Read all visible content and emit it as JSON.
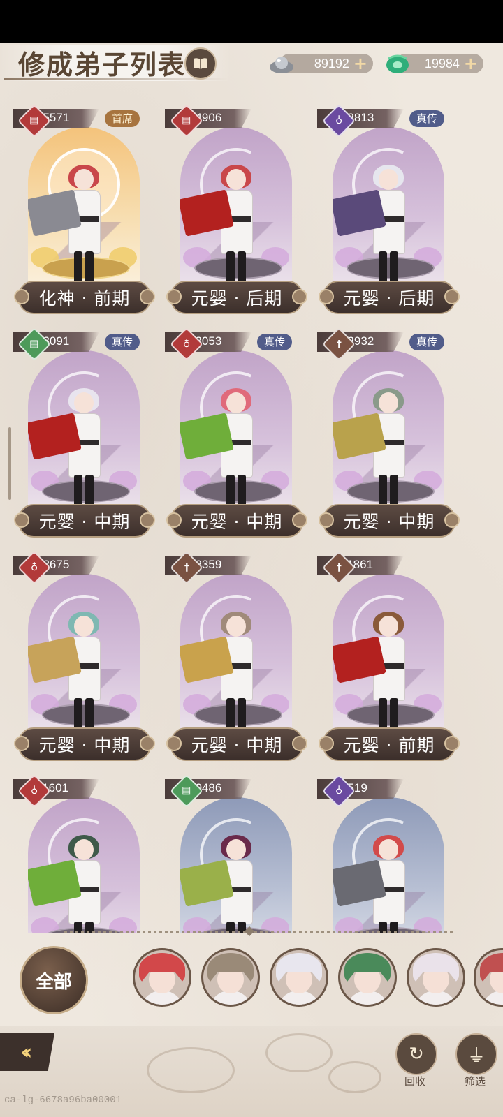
{
  "header": {
    "title": "修成弟子列表",
    "silver": "89192",
    "jade": "19984",
    "plus": "+"
  },
  "disciples": [
    {
      "power": "15571",
      "rank": "首席",
      "stage": "化神 · 前期",
      "type": "book",
      "bg": "gold",
      "hair": "#c9474a",
      "weapon": "#8a8a92"
    },
    {
      "power": "14906",
      "rank": "",
      "stage": "元婴 · 后期",
      "type": "book",
      "bg": "violet",
      "hair": "#c9474a",
      "weapon": "#b3211f"
    },
    {
      "power": "13813",
      "rank": "真传",
      "stage": "元婴 · 后期",
      "type": "gourd",
      "bg": "violet",
      "hair": "#e6e6ee",
      "weapon": "#5a4a7a"
    },
    {
      "power": "13091",
      "rank": "真传",
      "stage": "元婴 · 中期",
      "type": "book",
      "bg": "violet",
      "hair": "#e8e4ee",
      "weapon": "#b3211f"
    },
    {
      "power": "13053",
      "rank": "真传",
      "stage": "元婴 · 中期",
      "type": "gourd",
      "bg": "violet",
      "hair": "#e06a7a",
      "weapon": "#6fae3a"
    },
    {
      "power": "12932",
      "rank": "真传",
      "stage": "元婴 · 中期",
      "type": "sword",
      "bg": "violet",
      "hair": "#8a9a8a",
      "weapon": "#b9a24c"
    },
    {
      "power": "12675",
      "rank": "",
      "stage": "元婴 · 中期",
      "type": "gourd",
      "bg": "violet",
      "hair": "#7fb8b2",
      "weapon": "#c7a35a"
    },
    {
      "power": "12359",
      "rank": "",
      "stage": "元婴 · 中期",
      "type": "sword",
      "bg": "violet",
      "hair": "#a08a7a",
      "weapon": "#c9a24c"
    },
    {
      "power": "11861",
      "rank": "",
      "stage": "元婴 · 前期",
      "type": "sword",
      "bg": "violet",
      "hair": "#8a5a3a",
      "weapon": "#b3211f"
    },
    {
      "power": "11601",
      "rank": "",
      "stage": "",
      "type": "gourd",
      "bg": "violet",
      "hair": "#3f5a4a",
      "weapon": "#6fae3a"
    },
    {
      "power": "10486",
      "rank": "",
      "stage": "",
      "type": "book",
      "bg": "night",
      "hair": "#6a2a4a",
      "weapon": "#9ab04a"
    },
    {
      "power": "9519",
      "rank": "",
      "stage": "",
      "type": "gourd",
      "bg": "night",
      "hair": "#d24a4a",
      "weapon": "#6a6a72"
    }
  ],
  "filter": {
    "all_label": "全部",
    "avatars": [
      {
        "hair": "#d2484a"
      },
      {
        "hair": "#9a8a78"
      },
      {
        "hair": "#e8e6ee"
      },
      {
        "hair": "#4a8a5a"
      },
      {
        "hair": "#eae2ea"
      },
      {
        "hair": "#c05050"
      }
    ]
  },
  "bottom": {
    "recycle_label": "回收",
    "filter_label": "筛选"
  },
  "watermark": "ca-lg-6678a96ba00001",
  "colors": {
    "book_icon": "#b23a3a",
    "gourd_icon": "#b23a3a",
    "sword_icon": "#7a5242",
    "green_icon": "#4d9a5a",
    "purple_icon": "#6a4aa0"
  }
}
